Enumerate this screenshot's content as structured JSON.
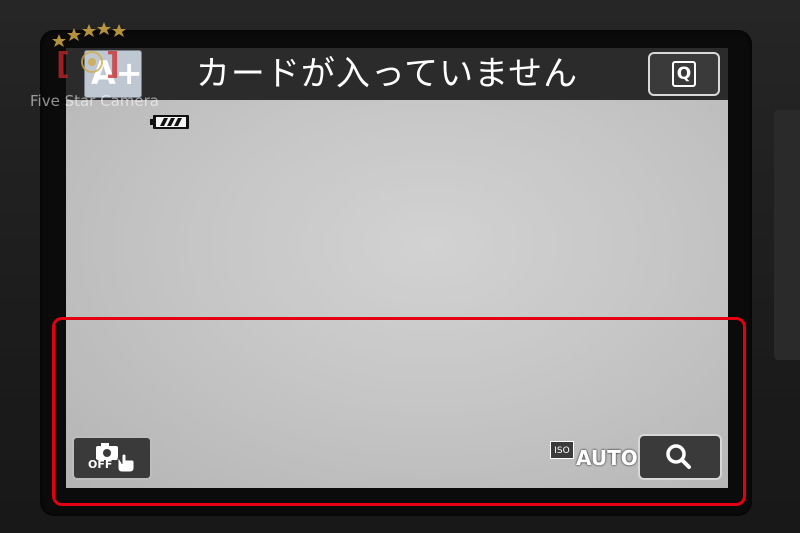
{
  "screen": {
    "message": "カードが入っていません",
    "mode_button_label": "A+",
    "quick_button_label": "Q"
  },
  "status": {
    "battery_icon": "battery-full-icon",
    "iso_label": "ISO",
    "iso_value": "AUTO"
  },
  "controls": {
    "touch_shutter_label": "OFF",
    "magnify_icon": "magnify-icon"
  },
  "watermark": {
    "text": "Five Star Camera"
  },
  "colors": {
    "highlight": "#e30012",
    "screen_bg": "#c6c6c6",
    "bar_bg": "#2b2b2b"
  }
}
